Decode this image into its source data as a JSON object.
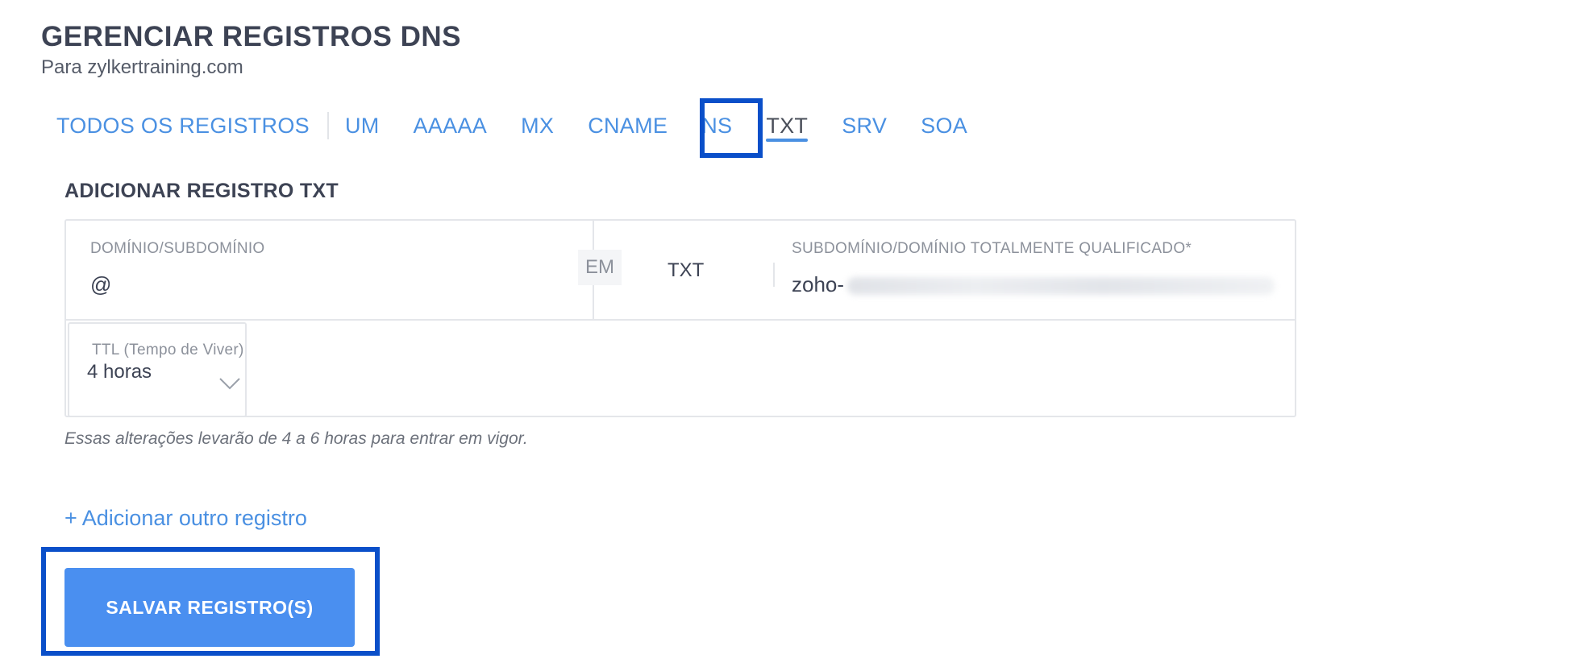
{
  "header": {
    "title": "GERENCIAR REGISTROS DNS",
    "subtitle": "Para zylkertraining.com"
  },
  "tabs": [
    {
      "label": "TODOS OS REGISTROS",
      "active": false
    },
    {
      "label": "UM",
      "active": false
    },
    {
      "label": "AAAAA",
      "active": false
    },
    {
      "label": "MX",
      "active": false
    },
    {
      "label": "CNAME",
      "active": false
    },
    {
      "label": "NS",
      "active": false
    },
    {
      "label": "TXT",
      "active": true
    },
    {
      "label": "SRV",
      "active": false
    },
    {
      "label": "SOA",
      "active": false
    }
  ],
  "form": {
    "section_title": "ADICIONAR REGISTRO TXT",
    "domain_label": "DOMÍNIO/SUBDOMÍNIO",
    "domain_value": "@",
    "em_label": "EM",
    "type_value": "TXT",
    "fqdn_label": "SUBDOMÍNIO/DOMÍNIO TOTALMENTE QUALIFICADO*",
    "fqdn_value_visible": "zoho-",
    "ttl_label": "TTL (Tempo de Viver)",
    "ttl_value": "4 horas",
    "note": "Essas alterações levarão de 4 a 6 horas para entrar em vigor."
  },
  "actions": {
    "add_record": "+ Adicionar outro registro",
    "save": "SALVAR REGISTRO(S)"
  },
  "colors": {
    "accent": "#4a90e2",
    "highlight": "#0a4fc9",
    "button": "#4a8ff0"
  }
}
